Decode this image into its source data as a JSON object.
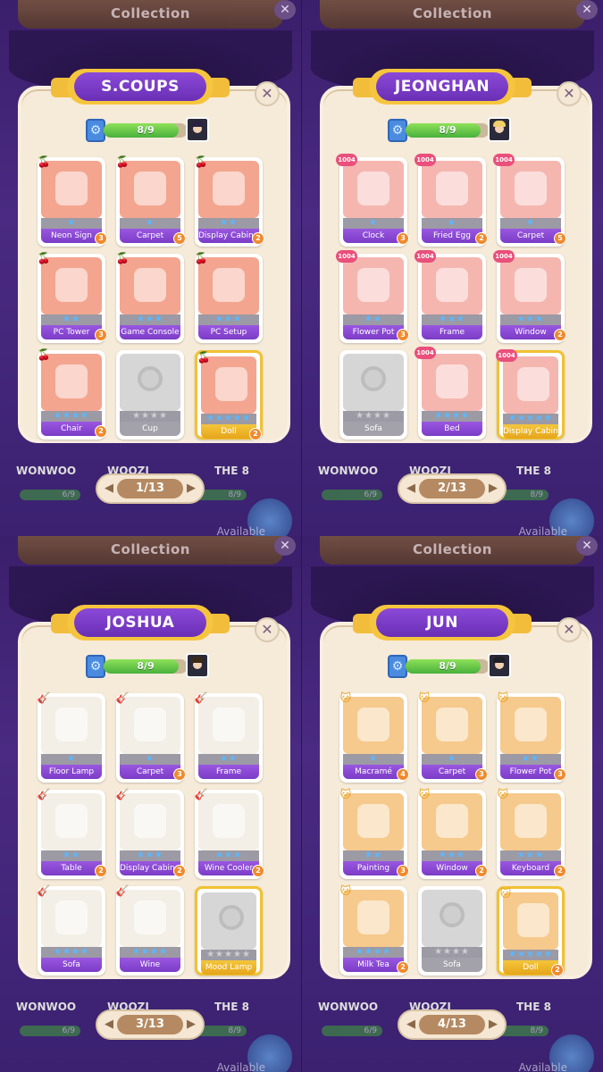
{
  "screens": [
    {
      "bg_title": "Collection",
      "member": "S.COUPS",
      "progress": "8/9",
      "progress_fraction": 0.89,
      "avatar_hair": "#2a2240",
      "page": "1/13",
      "bg_names": [
        "WONWOO",
        "WOOZI",
        "THE 8"
      ],
      "bg_bars": [
        "6/9",
        "8/9"
      ],
      "bg_avail": "Available",
      "tag_icon": "cherry-icon",
      "cards": [
        {
          "label": "Neon Sign",
          "stars": "★",
          "badge": "3",
          "color": "#f3a58f",
          "locked": false,
          "gold": false
        },
        {
          "label": "Carpet",
          "stars": "★",
          "badge": "5",
          "color": "#f3a58f",
          "locked": false,
          "gold": false
        },
        {
          "label": "Display Cabinet",
          "stars": "★★",
          "badge": "2",
          "color": "#f3a58f",
          "locked": false,
          "gold": false
        },
        {
          "label": "PC Tower",
          "stars": "★★",
          "badge": "3",
          "color": "#f3a58f",
          "locked": false,
          "gold": false
        },
        {
          "label": "Game Console",
          "stars": "★★★",
          "badge": "",
          "color": "#f3a58f",
          "locked": false,
          "gold": false
        },
        {
          "label": "PC Setup",
          "stars": "★★★",
          "badge": "",
          "color": "#f3a58f",
          "locked": false,
          "gold": false
        },
        {
          "label": "Chair",
          "stars": "★★★★",
          "badge": "2",
          "color": "#f3a58f",
          "locked": false,
          "gold": false
        },
        {
          "label": "Cup",
          "stars": "★★★★",
          "badge": "",
          "color": "#d6d6d6",
          "locked": true,
          "gold": false
        },
        {
          "label": "Doll",
          "stars": "★★★★★",
          "badge": "2",
          "color": "#f3a58f",
          "locked": false,
          "gold": true
        }
      ]
    },
    {
      "bg_title": "Collection",
      "member": "JEONGHAN",
      "progress": "8/9",
      "progress_fraction": 0.89,
      "avatar_hair": "#f0d068",
      "page": "2/13",
      "bg_names": [
        "WONWOO",
        "WOOZI",
        "THE 8"
      ],
      "bg_bars": [
        "6/9",
        "8/9"
      ],
      "bg_avail": "Available",
      "tag_icon": "heart-1004-icon",
      "tag_text": "1004",
      "cards": [
        {
          "label": "Clock",
          "stars": "★",
          "badge": "3",
          "color": "#f5b6b0",
          "locked": false,
          "gold": false
        },
        {
          "label": "Fried Egg",
          "stars": "★",
          "badge": "2",
          "color": "#f5b6b0",
          "locked": false,
          "gold": false
        },
        {
          "label": "Carpet",
          "stars": "★",
          "badge": "5",
          "color": "#f5b6b0",
          "locked": false,
          "gold": false
        },
        {
          "label": "Flower Pot",
          "stars": "★★",
          "badge": "3",
          "color": "#f5b6b0",
          "locked": false,
          "gold": false
        },
        {
          "label": "Frame",
          "stars": "★★★",
          "badge": "",
          "color": "#f5b6b0",
          "locked": false,
          "gold": false
        },
        {
          "label": "Window",
          "stars": "★★★",
          "badge": "2",
          "color": "#f5b6b0",
          "locked": false,
          "gold": false
        },
        {
          "label": "Sofa",
          "stars": "★★★★",
          "badge": "",
          "color": "#d6d6d6",
          "locked": true,
          "gold": false
        },
        {
          "label": "Bed",
          "stars": "★★★★",
          "badge": "",
          "color": "#f5b6b0",
          "locked": false,
          "gold": false
        },
        {
          "label": "Display Cabinet",
          "stars": "★★★★★",
          "badge": "",
          "color": "#f5b6b0",
          "locked": false,
          "gold": true
        }
      ]
    },
    {
      "bg_title": "Collection",
      "member": "JOSHUA",
      "progress": "8/9",
      "progress_fraction": 0.89,
      "avatar_hair": "#3a2a1a",
      "page": "3/13",
      "bg_names": [
        "WONWOO",
        "WOOZI",
        "THE 8"
      ],
      "bg_bars": [
        "6/9",
        "8/9"
      ],
      "bg_avail": "Available",
      "tag_icon": "guitar-icon",
      "cards": [
        {
          "label": "Floor Lamp",
          "stars": "★",
          "badge": "",
          "color": "#f3efe6",
          "locked": false,
          "gold": false
        },
        {
          "label": "Carpet",
          "stars": "★",
          "badge": "3",
          "color": "#f3efe6",
          "locked": false,
          "gold": false
        },
        {
          "label": "Frame",
          "stars": "★★",
          "badge": "",
          "color": "#f3efe6",
          "locked": false,
          "gold": false
        },
        {
          "label": "Table",
          "stars": "★★",
          "badge": "2",
          "color": "#f3efe6",
          "locked": false,
          "gold": false
        },
        {
          "label": "Display Cabinet",
          "stars": "★★★",
          "badge": "2",
          "color": "#f3efe6",
          "locked": false,
          "gold": false
        },
        {
          "label": "Wine Cooler",
          "stars": "★★★",
          "badge": "2",
          "color": "#f3efe6",
          "locked": false,
          "gold": false
        },
        {
          "label": "Sofa",
          "stars": "★★★★",
          "badge": "",
          "color": "#f3efe6",
          "locked": false,
          "gold": false
        },
        {
          "label": "Wine",
          "stars": "★★★★",
          "badge": "",
          "color": "#f3efe6",
          "locked": false,
          "gold": false
        },
        {
          "label": "Mood Lamp",
          "stars": "★★★★★",
          "badge": "",
          "color": "#d6d6d6",
          "locked": true,
          "gold": true
        }
      ]
    },
    {
      "bg_title": "Collection",
      "member": "JUN",
      "progress": "8/9",
      "progress_fraction": 0.89,
      "avatar_hair": "#1f1f2a",
      "page": "4/13",
      "bg_names": [
        "WONWOO",
        "WOOZI",
        "THE 8"
      ],
      "bg_bars": [
        "6/9",
        "8/9"
      ],
      "bg_avail": "Available",
      "tag_icon": "cat-icon",
      "cards": [
        {
          "label": "Macramé",
          "stars": "★",
          "badge": "4",
          "color": "#f6c98c",
          "locked": false,
          "gold": false
        },
        {
          "label": "Carpet",
          "stars": "★",
          "badge": "3",
          "color": "#f6c98c",
          "locked": false,
          "gold": false
        },
        {
          "label": "Flower Pot",
          "stars": "★★",
          "badge": "3",
          "color": "#f6c98c",
          "locked": false,
          "gold": false
        },
        {
          "label": "Painting",
          "stars": "★★",
          "badge": "3",
          "color": "#f6c98c",
          "locked": false,
          "gold": false
        },
        {
          "label": "Window",
          "stars": "★★★",
          "badge": "2",
          "color": "#f6c98c",
          "locked": false,
          "gold": false
        },
        {
          "label": "Keyboard",
          "stars": "★★★",
          "badge": "2",
          "color": "#f6c98c",
          "locked": false,
          "gold": false
        },
        {
          "label": "Milk Tea",
          "stars": "★★★★",
          "badge": "2",
          "color": "#f6c98c",
          "locked": false,
          "gold": false
        },
        {
          "label": "Sofa",
          "stars": "★★★★",
          "badge": "",
          "color": "#d6d6d6",
          "locked": true,
          "gold": false
        },
        {
          "label": "Doll",
          "stars": "★★★★★",
          "badge": "2",
          "color": "#f6c98c",
          "locked": false,
          "gold": true
        }
      ]
    }
  ]
}
